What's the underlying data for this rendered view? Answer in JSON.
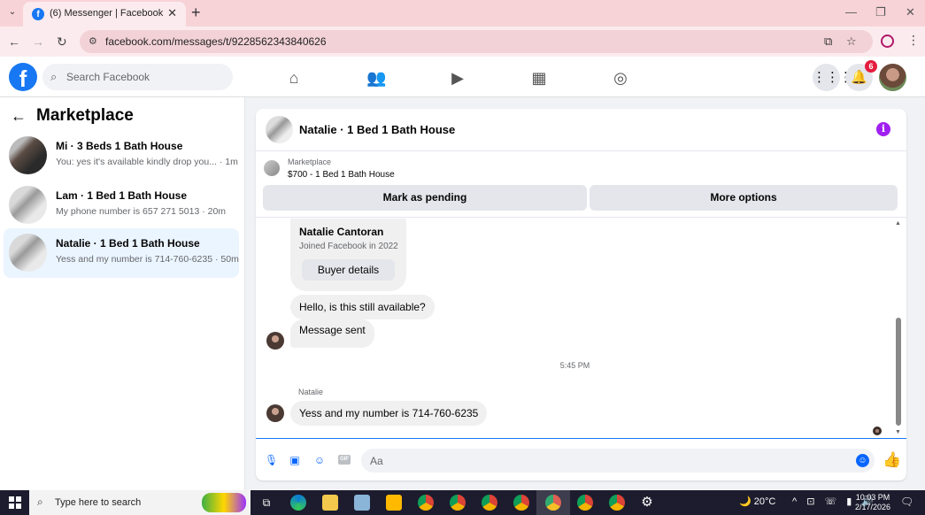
{
  "browser": {
    "tab_title": "(6) Messenger | Facebook",
    "new_tab": "+",
    "url": "facebook.com/messages/t/9228562343840626"
  },
  "fb_header": {
    "search_placeholder": "Search Facebook",
    "notification_count": "6"
  },
  "sidebar": {
    "title": "Marketplace",
    "conversations": [
      {
        "name": "Mi · 3 Beds 1 Bath House",
        "snippet": "You: yes it's available kindly drop you... · 1m"
      },
      {
        "name": "Lam · 1 Bed 1 Bath House",
        "snippet": "My phone number is 657 271 5013 · 20m"
      },
      {
        "name": "Natalie · 1 Bed 1 Bath House",
        "snippet": "Yess and my number is 714-760-6235 · 50m"
      }
    ]
  },
  "chat": {
    "title": "Natalie · 1 Bed 1 Bath House",
    "listing": {
      "source": "Marketplace",
      "price_title": "$700 - 1 Bed 1 Bath House",
      "mark_pending": "Mark as pending",
      "more_options": "More options"
    },
    "profile_card": {
      "name": "Natalie Cantoran",
      "joined": "Joined Facebook in 2022",
      "buyer_details": "Buyer details"
    },
    "messages": [
      "Hello, is this still available?",
      "Message sent"
    ],
    "timestamp": "5:45 PM",
    "sender_label": "Natalie",
    "last_message": "Yess and my number is 714-760-6235",
    "composer_placeholder": "Aa",
    "gif_label": "GIF"
  },
  "taskbar": {
    "search_placeholder": "Type here to search",
    "weather": "20°C",
    "time": "10:03 PM",
    "date": "2/17/2026"
  }
}
